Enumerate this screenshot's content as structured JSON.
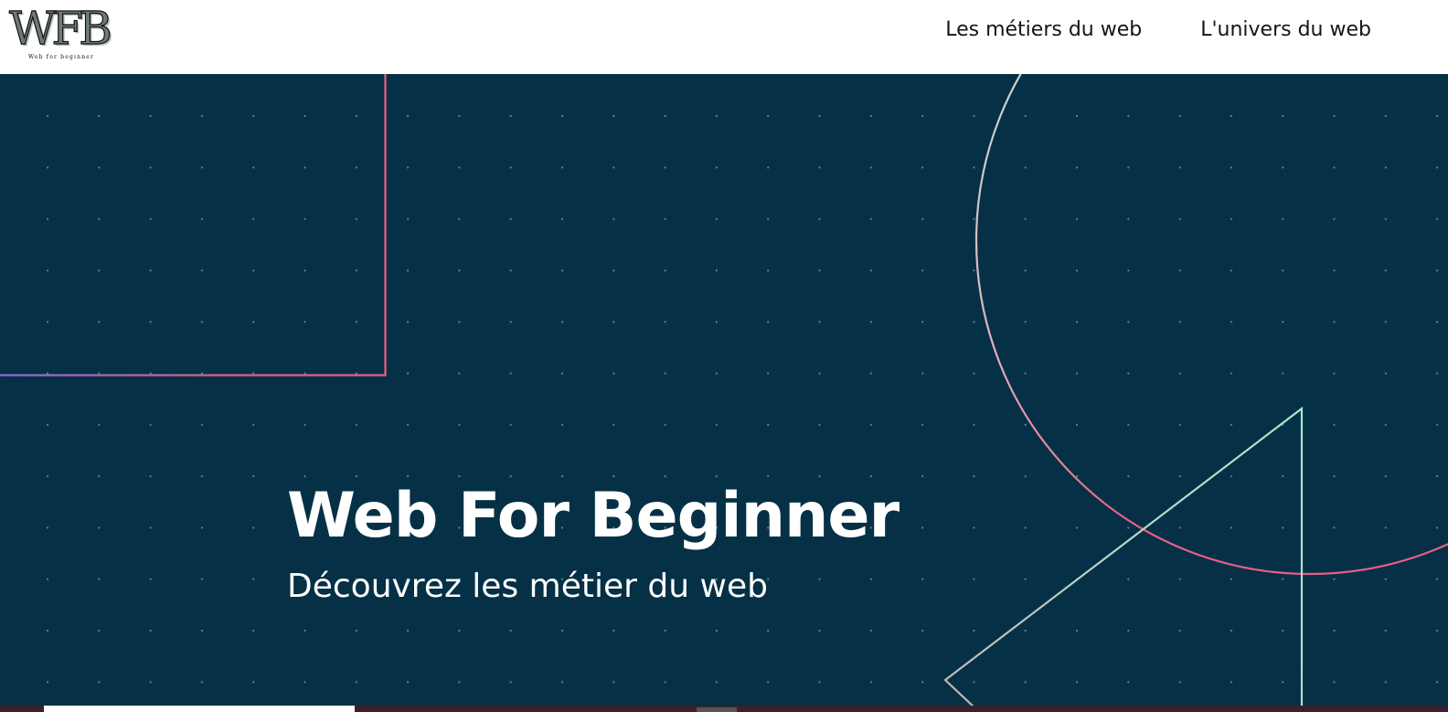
{
  "header": {
    "logo": {
      "mark": "WFB",
      "tagline": "Web for beginner"
    },
    "nav": [
      {
        "label": "Les métiers du web"
      },
      {
        "label": "L'univers du web"
      }
    ]
  },
  "hero": {
    "title": "Web For Beginner",
    "subtitle": "Découvrez les métier du web",
    "colors": {
      "background": "#053045",
      "accent_pink": "#e85f86",
      "accent_mint": "#a7e7c8"
    }
  }
}
